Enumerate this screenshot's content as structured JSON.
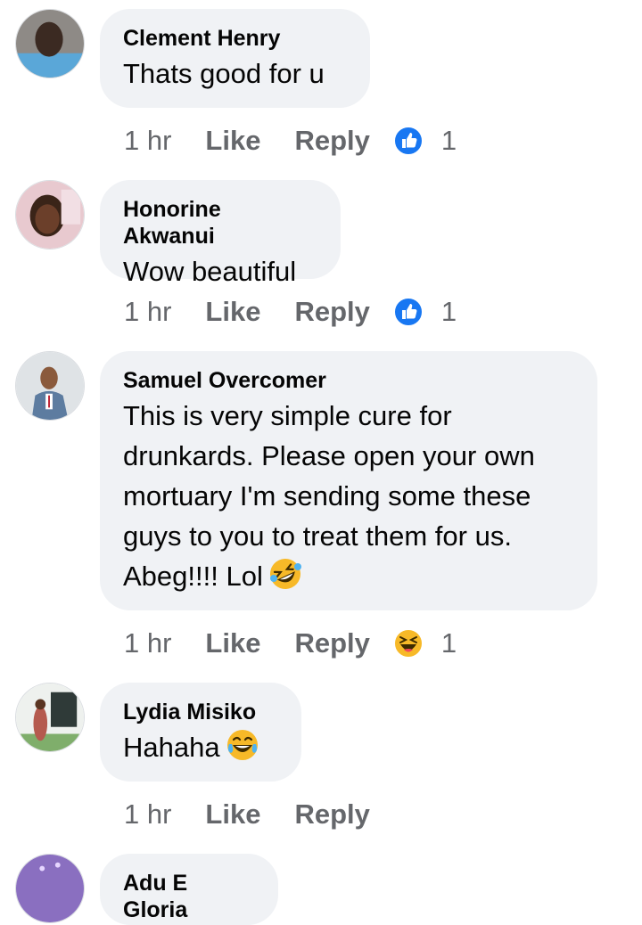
{
  "comments": [
    {
      "author": "Clement Henry",
      "text": "Thats good for u",
      "time": "1 hr",
      "like": "Like",
      "reply": "Reply",
      "reaction": "like-icon",
      "reaction_count": "1"
    },
    {
      "author": "Honorine Akwanui",
      "text": "Wow beautiful",
      "time": "1 hr",
      "like": "Like",
      "reply": "Reply",
      "reaction": "like-icon",
      "reaction_count": "1"
    },
    {
      "author": "Samuel Overcomer",
      "text_lines": [
        "This is very simple cure for",
        "drunkards. Please open your own",
        "mortuary I'm sending some these",
        "guys to you to treat them for us.",
        "Abeg!!!! Lol"
      ],
      "text_emoji": "rolling-laughing-emoji",
      "time": "1 hr",
      "like": "Like",
      "reply": "Reply",
      "reaction": "haha-icon",
      "reaction_count": "1"
    },
    {
      "author": "Lydia Misiko",
      "text": "Hahaha",
      "text_emoji": "tears-of-joy-emoji",
      "time": "1 hr",
      "like": "Like",
      "reply": "Reply"
    },
    {
      "author": "Adu E Gloria"
    }
  ],
  "colors": {
    "bubble": "#f0f2f5",
    "meta": "#65676b",
    "like_blue": "#1877f2",
    "haha_yellow": "#f7b928"
  }
}
